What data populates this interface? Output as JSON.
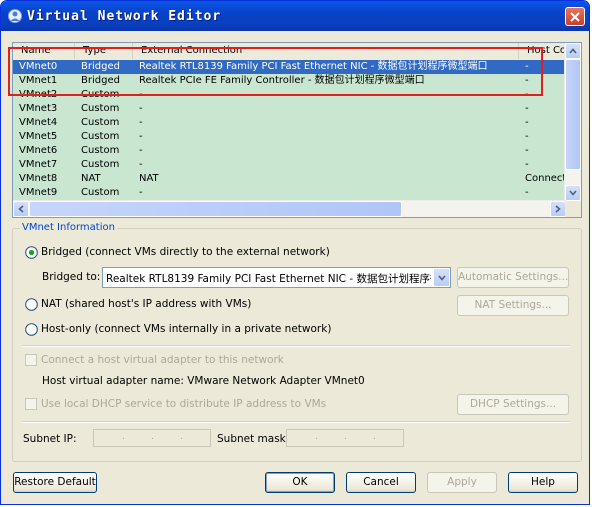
{
  "window": {
    "title": "Virtual Network Editor",
    "close_icon": "close-icon"
  },
  "list": {
    "columns": [
      "Name",
      "Type",
      "External Connection",
      "Host Con"
    ],
    "rows": [
      {
        "name": "VMnet0",
        "type": "Bridged",
        "external": "Realtek RTL8139 Family PCI Fast Ethernet NIC - 数据包计划程序微型端口",
        "host": "-",
        "selected": true
      },
      {
        "name": "VMnet1",
        "type": "Bridged",
        "external": "Realtek PCIe FE Family Controller - 数据包计划程序微型端口",
        "host": "-",
        "selected": false
      },
      {
        "name": "VMnet2",
        "type": "Custom",
        "external": "-",
        "host": "-",
        "selected": false
      },
      {
        "name": "VMnet3",
        "type": "Custom",
        "external": "-",
        "host": "-",
        "selected": false
      },
      {
        "name": "VMnet4",
        "type": "Custom",
        "external": "-",
        "host": "-",
        "selected": false
      },
      {
        "name": "VMnet5",
        "type": "Custom",
        "external": "-",
        "host": "-",
        "selected": false
      },
      {
        "name": "VMnet6",
        "type": "Custom",
        "external": "-",
        "host": "-",
        "selected": false
      },
      {
        "name": "VMnet7",
        "type": "Custom",
        "external": "-",
        "host": "-",
        "selected": false
      },
      {
        "name": "VMnet8",
        "type": "NAT",
        "external": "NAT",
        "host": "Connecte",
        "selected": false
      },
      {
        "name": "VMnet9",
        "type": "Custom",
        "external": "-",
        "host": "-",
        "selected": false
      }
    ]
  },
  "info": {
    "legend": "VMnet Information",
    "bridged_label": "Bridged (connect VMs directly to the external network)",
    "bridged_to_label": "Bridged to:",
    "bridged_to_value": "Realtek RTL8139 Family PCI Fast Ethernet NIC - 数据包计划程序微",
    "auto_settings": "Automatic Settings...",
    "nat_label": "NAT (shared host's IP address with VMs)",
    "nat_settings": "NAT Settings...",
    "hostonly_label": "Host-only (connect VMs internally in a private network)",
    "connect_adapter_label": "Connect a host virtual adapter to this network",
    "adapter_name_label": "Host virtual adapter name: VMware Network Adapter VMnet0",
    "dhcp_label": "Use local DHCP service to distribute IP address to VMs",
    "dhcp_settings": "DHCP Settings...",
    "subnet_ip_label": "Subnet IP:",
    "subnet_mask_label": "Subnet mask:"
  },
  "footer": {
    "restore": "Restore Default",
    "ok": "OK",
    "cancel": "Cancel",
    "apply": "Apply",
    "help": "Help"
  },
  "colors": {
    "title_bar": "#0a46d0",
    "selection": "#316ac5",
    "list_bg": "#c8e6d0",
    "highlight_box": "#e0201c",
    "group_legend": "#0046d5"
  }
}
